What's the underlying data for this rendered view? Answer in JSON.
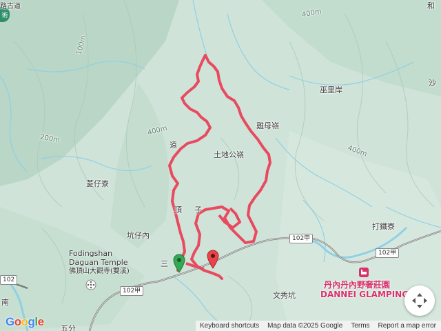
{
  "map": {
    "labels": {
      "tugonglin": "土地公嶺",
      "jimuling": "雞母嶺",
      "wuliyan": "巫里岸",
      "sha": "沙",
      "he": "和",
      "lingzailiao": "菱仔寮",
      "kengzinei": "坑仔內",
      "dingzi": "頂",
      "dingzi2": "子",
      "yuan": "遠",
      "sanjiao": "三",
      "wenxiukeng": "文秀坑",
      "datieliao": "打鐵寮",
      "nan": "南",
      "wufen": "五分",
      "jiu": "路古道",
      "contour_400_a": "400m",
      "contour_400_b": "400m",
      "contour_200": "200m",
      "contour_100": "100m",
      "contour_400_c": "400m"
    },
    "roads": {
      "r1": "102甲",
      "r2": "102甲",
      "r3": "102甲",
      "r4": "102"
    },
    "pois": {
      "temple_en_1": "Fodingshan",
      "temple_en_2": "Daguan Temple",
      "temple_zh": "佛頂山大觀寺(雙溪)",
      "glamping_zh": "丹內丹內野奢莊園",
      "glamping_en": "DANNEI GLAMPING"
    },
    "colors": {
      "track": "#e84a5f",
      "start_marker": "#34a853",
      "end_marker": "#e8444a",
      "road": "#6b6b6b",
      "glamping": "#d6336c"
    }
  },
  "footer": {
    "keyboard": "Keyboard shortcuts",
    "map_data": "Map data ©2025 Google",
    "terms": "Terms",
    "report": "Report a map error"
  },
  "logo": "Google"
}
